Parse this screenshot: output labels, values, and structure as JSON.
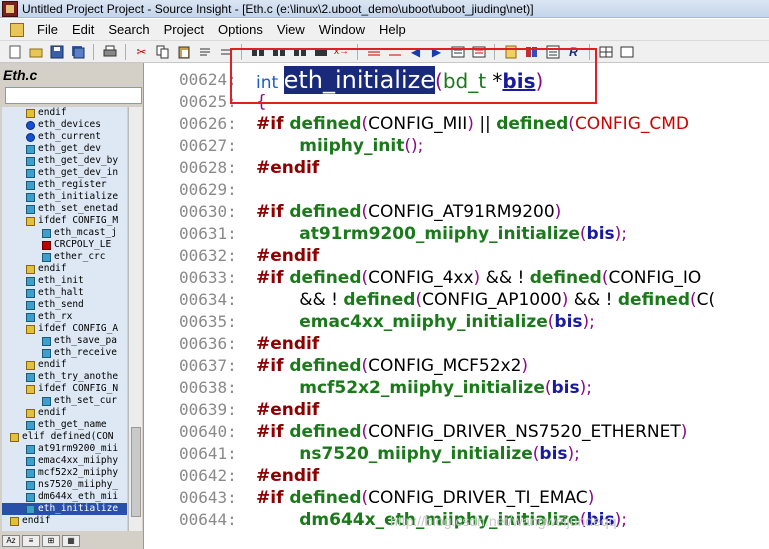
{
  "window": {
    "title": "Untitled Project Project - Source Insight - [Eth.c (e:\\linux\\2.uboot_demo\\uboot\\uboot_jiuding\\net)]"
  },
  "menu": {
    "items": [
      "File",
      "Edit",
      "Search",
      "Project",
      "Options",
      "View",
      "Window",
      "Help"
    ]
  },
  "sidebar": {
    "title": "Eth.c",
    "symbols": [
      {
        "icon": "ifdef",
        "text": "endif",
        "indent": 1
      },
      {
        "icon": "var",
        "text": "eth_devices",
        "indent": 1
      },
      {
        "icon": "var",
        "text": "eth_current",
        "indent": 1
      },
      {
        "icon": "func",
        "text": "eth_get_dev",
        "indent": 1
      },
      {
        "icon": "func",
        "text": "eth_get_dev_by",
        "indent": 1
      },
      {
        "icon": "func",
        "text": "eth_get_dev_in",
        "indent": 1
      },
      {
        "icon": "func",
        "text": "eth_register",
        "indent": 1
      },
      {
        "icon": "func",
        "text": "eth_initialize",
        "indent": 1
      },
      {
        "icon": "func",
        "text": "eth_set_enetad",
        "indent": 1
      },
      {
        "icon": "ifdef",
        "text": "ifdef CONFIG_M",
        "indent": 1
      },
      {
        "icon": "func",
        "text": "eth_mcast_j",
        "indent": 2
      },
      {
        "icon": "macro",
        "text": "CRCPOLY_LE",
        "indent": 2
      },
      {
        "icon": "func",
        "text": "ether_crc",
        "indent": 2
      },
      {
        "icon": "ifdef",
        "text": "endif",
        "indent": 1
      },
      {
        "icon": "func",
        "text": "eth_init",
        "indent": 1
      },
      {
        "icon": "func",
        "text": "eth_halt",
        "indent": 1
      },
      {
        "icon": "func",
        "text": "eth_send",
        "indent": 1
      },
      {
        "icon": "func",
        "text": "eth_rx",
        "indent": 1
      },
      {
        "icon": "ifdef",
        "text": "ifdef CONFIG_A",
        "indent": 1
      },
      {
        "icon": "func",
        "text": "eth_save_pa",
        "indent": 2
      },
      {
        "icon": "func",
        "text": "eth_receive",
        "indent": 2
      },
      {
        "icon": "ifdef",
        "text": "endif",
        "indent": 1
      },
      {
        "icon": "func",
        "text": "eth_try_anothe",
        "indent": 1
      },
      {
        "icon": "ifdef",
        "text": "ifdef CONFIG_N",
        "indent": 1
      },
      {
        "icon": "func",
        "text": "eth_set_cur",
        "indent": 2
      },
      {
        "icon": "ifdef",
        "text": "endif",
        "indent": 1
      },
      {
        "icon": "func",
        "text": "eth_get_name",
        "indent": 1
      },
      {
        "icon": "ifdef",
        "text": "elif defined(CON",
        "indent": 0
      },
      {
        "icon": "func",
        "text": "at91rm9200_mii",
        "indent": 1
      },
      {
        "icon": "func",
        "text": "emac4xx_miiphy",
        "indent": 1
      },
      {
        "icon": "func",
        "text": "mcf52x2_miiphy",
        "indent": 1
      },
      {
        "icon": "func",
        "text": "ns7520_miiphy_",
        "indent": 1
      },
      {
        "icon": "func",
        "text": "dm644x_eth_mii",
        "indent": 1
      },
      {
        "icon": "func",
        "text": "eth_initialize",
        "indent": 1,
        "selected": true
      },
      {
        "icon": "ifdef",
        "text": "endif",
        "indent": 0
      }
    ]
  },
  "editor": {
    "lines": [
      {
        "n": "00624:",
        "html": "<span class='type'>int </span><span class='hl'>eth_initialize</span><span class='p' style='font-size:20px'>(</span><span class='def' style='font-weight:normal;font-size:20px;color:#1a7a1a'>bd_t </span><span class='op' style='font-size:20px'>*</span><span class='var' style='font-size:20px;text-decoration:underline'>bis</span><span class='p' style='font-size:20px'>)</span>"
      },
      {
        "n": "00625:",
        "html": "<span class='p'>{</span>"
      },
      {
        "n": "00626:",
        "html": "<span class='kw'>#if </span><span class='def'>defined</span><span class='p'>(</span><span class='m'>CONFIG_MII</span><span class='p'>) </span><span class='op'>|| </span><span class='def'>defined</span><span class='p'>(</span><span class='red'>CONFIG_CMD</span>"
      },
      {
        "n": "00627:",
        "html": "&nbsp;&nbsp;&nbsp;&nbsp;&nbsp;&nbsp;&nbsp;&nbsp;<span class='fn'>miiphy_init</span><span class='p'>();</span>"
      },
      {
        "n": "00628:",
        "html": "<span class='kw'>#endif</span>"
      },
      {
        "n": "00629:",
        "html": ""
      },
      {
        "n": "00630:",
        "html": "<span class='kw'>#if </span><span class='def'>defined</span><span class='p'>(</span><span class='m'>CONFIG_AT91RM9200</span><span class='p'>)</span>"
      },
      {
        "n": "00631:",
        "html": "&nbsp;&nbsp;&nbsp;&nbsp;&nbsp;&nbsp;&nbsp;&nbsp;<span class='fn'>at91rm9200_miiphy_initialize</span><span class='p'>(</span><span class='var'>bis</span><span class='p'>);</span>"
      },
      {
        "n": "00632:",
        "html": "<span class='kw'>#endif</span>"
      },
      {
        "n": "00633:",
        "html": "<span class='kw'>#if </span><span class='def'>defined</span><span class='p'>(</span><span class='m'>CONFIG_4xx</span><span class='p'>) </span><span class='op'>&amp;&amp; ! </span><span class='def'>defined</span><span class='p'>(</span><span class='m'>CONFIG_IO</span>"
      },
      {
        "n": "00634:",
        "html": "&nbsp;&nbsp;&nbsp;&nbsp;&nbsp;&nbsp;&nbsp;&nbsp;<span class='op'>&amp;&amp; ! </span><span class='def'>defined</span><span class='p'>(</span><span class='m'>CONFIG_AP1000</span><span class='p'>) </span><span class='op'>&amp;&amp; ! </span><span class='def'>defined</span><span class='p'>(</span><span class='m'>C(</span>"
      },
      {
        "n": "00635:",
        "html": "&nbsp;&nbsp;&nbsp;&nbsp;&nbsp;&nbsp;&nbsp;&nbsp;<span class='fn'>emac4xx_miiphy_initialize</span><span class='p'>(</span><span class='var'>bis</span><span class='p'>);</span>"
      },
      {
        "n": "00636:",
        "html": "<span class='kw'>#endif</span>"
      },
      {
        "n": "00637:",
        "html": "<span class='kw'>#if </span><span class='def'>defined</span><span class='p'>(</span><span class='m'>CONFIG_MCF52x2</span><span class='p'>)</span>"
      },
      {
        "n": "00638:",
        "html": "&nbsp;&nbsp;&nbsp;&nbsp;&nbsp;&nbsp;&nbsp;&nbsp;<span class='fn'>mcf52x2_miiphy_initialize</span><span class='p'>(</span><span class='var'>bis</span><span class='p'>);</span>"
      },
      {
        "n": "00639:",
        "html": "<span class='kw'>#endif</span>"
      },
      {
        "n": "00640:",
        "html": "<span class='kw'>#if </span><span class='def'>defined</span><span class='p'>(</span><span class='m'>CONFIG_DRIVER_NS7520_ETHERNET</span><span class='p'>)</span>"
      },
      {
        "n": "00641:",
        "html": "&nbsp;&nbsp;&nbsp;&nbsp;&nbsp;&nbsp;&nbsp;&nbsp;<span class='fn'>ns7520_miiphy_initialize</span><span class='p'>(</span><span class='var'>bis</span><span class='p'>);</span>"
      },
      {
        "n": "00642:",
        "html": "<span class='kw'>#endif</span>"
      },
      {
        "n": "00643:",
        "html": "<span class='kw'>#if </span><span class='def'>defined</span><span class='p'>(</span><span class='m'>CONFIG_DRIVER_TI_EMAC</span><span class='p'>)</span>"
      },
      {
        "n": "00644:",
        "html": "&nbsp;&nbsp;&nbsp;&nbsp;&nbsp;&nbsp;&nbsp;&nbsp;<span class='fn'>dm644x_eth_miiphy_initialize</span><span class='p'>(</span><span class='var'>bis</span><span class='p'>);</span>"
      }
    ]
  },
  "watermark": "http://blog.csdn.net/wangweijundeqq"
}
